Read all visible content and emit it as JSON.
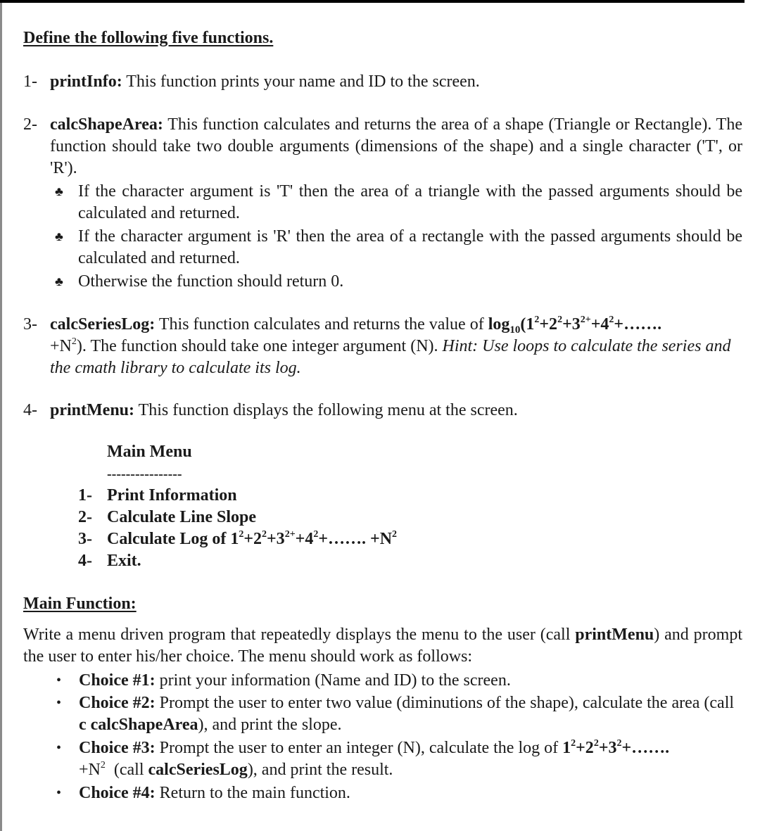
{
  "heading": "Define the following five functions.",
  "functions": [
    {
      "number": "1-",
      "name": "printInfo:",
      "text": " This function prints your name and ID to the screen."
    },
    {
      "number": "2-",
      "name": "calcShapeArea:",
      "text": " This function calculates and returns the area of a shape (Triangle or Rectangle). The function should take two double arguments (dimensions of the shape) and a single character ('T', or 'R').",
      "bullets": [
        "If the character argument is 'T' then the area of a triangle with the passed arguments should be calculated and returned.",
        "If the character argument is 'R' then the area of a rectangle with the passed arguments should be calculated and returned.",
        "Otherwise the function should return 0."
      ],
      "bullet_icon": "♣"
    },
    {
      "number": "3-",
      "name": "calcSeriesLog:",
      "text_before": " This function calculates and returns the value of ",
      "formula": {
        "log": "log",
        "base": "10",
        "open": "(1",
        "t1": "+2",
        "t2": "+3",
        "t3": "+4",
        "t4": "+…….",
        "sq": "2",
        "sq_plus": "2+",
        "tail": "+N",
        "close": ")."
      },
      "text_after": " The function should take one integer argument (N). ",
      "hint": "Hint: Use loops to calculate the series and the cmath library to calculate its log."
    },
    {
      "number": "4-",
      "name": "printMenu:",
      "text": " This function displays the following menu at the screen."
    }
  ],
  "menu": {
    "title": "Main Menu",
    "divider": "----------------",
    "items": [
      {
        "num": "1-",
        "label": "Print Information"
      },
      {
        "num": "2-",
        "label": "Calculate Line Slope"
      },
      {
        "num": "3-",
        "label": "Calculate Log of 1",
        "formula": {
          "t1": "+2",
          "t2": "+3",
          "t3": "+4",
          "t4": "+……. +N",
          "sq": "2",
          "sq_plus": "2+"
        }
      },
      {
        "num": "4-",
        "label": "Exit."
      }
    ]
  },
  "main_function": {
    "heading": "Main Function:",
    "para_before": "Write a menu driven program that repeatedly displays the menu to the user (call ",
    "para_bold": "printMenu",
    "para_after": ") and prompt the user to enter his/her choice. The menu should work as follows:",
    "bullet_icon": "•",
    "choices": [
      {
        "label": "Choice #1:",
        "text": " print your information (Name and ID) to the screen."
      },
      {
        "label": "Choice #2:",
        "text": " Prompt the user to enter two value (diminutions of the shape), calculate the area (call ",
        "bold": "c calcShapeArea",
        "text_after": "), and print the slope."
      },
      {
        "label": "Choice #3:",
        "text": " Prompt the user to enter an integer (N), calculate the log of ",
        "formula": {
          "one": "1",
          "t1": "+2",
          "t2": "+3",
          "t3": "+…….",
          "sq": "2",
          "tail": "+N",
          "call": "  (call ",
          "bold": "calcSeriesLog",
          "after": "), and print the result."
        }
      },
      {
        "label": "Choice #4:",
        "text": " Return to the main function."
      }
    ]
  }
}
